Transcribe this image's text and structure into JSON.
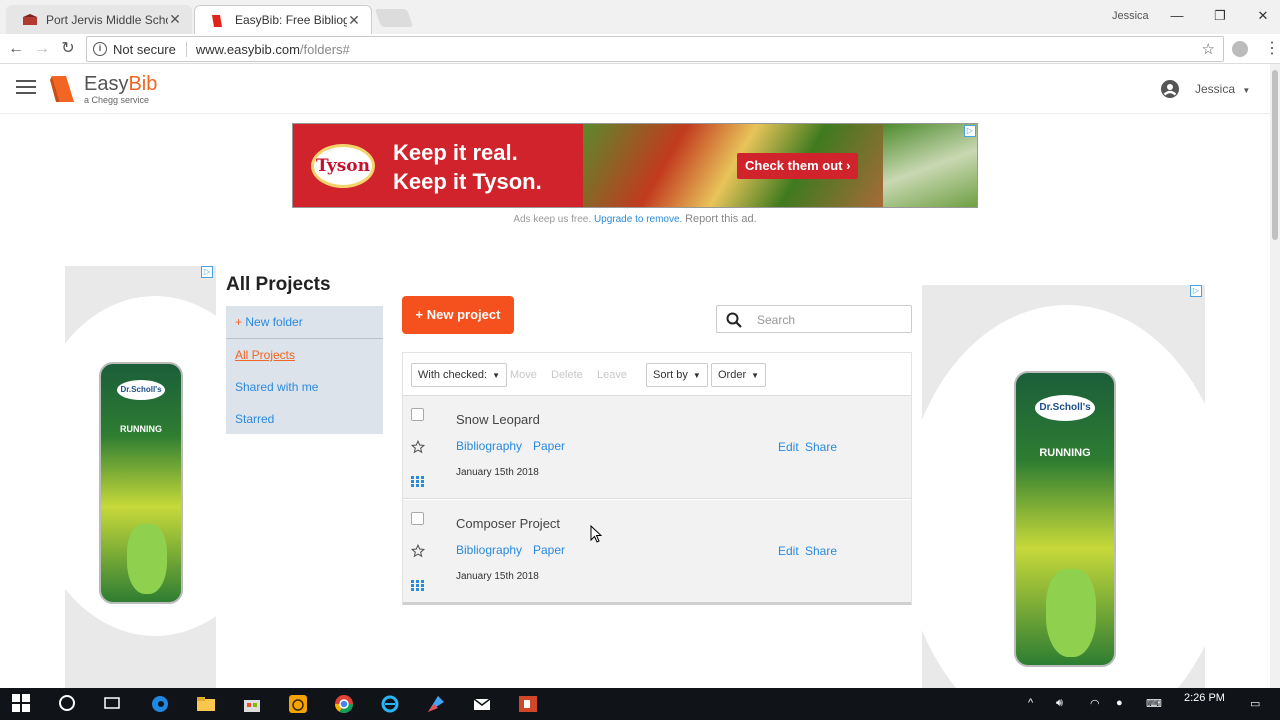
{
  "browser": {
    "tabs": [
      {
        "title": "Port Jervis Middle Schoo",
        "active": false
      },
      {
        "title": "EasyBib: Free Bibliograph",
        "active": true
      }
    ],
    "window_user": "Jessica",
    "window_controls": {
      "minimize": "—",
      "restore": "❐",
      "close": "✕"
    },
    "security": "Not secure",
    "url_host": "www.easybib.com",
    "url_path": "/folders#"
  },
  "header": {
    "brand_easy": "Easy",
    "brand_bib": "Bib",
    "tagline": "a Chegg service",
    "username": "Jessica",
    "accent": "#f26522"
  },
  "banner_ad": {
    "logo_text": "Tyson",
    "line1": "Keep it real.",
    "line2": "Keep it Tyson.",
    "cta": "Check them out ›",
    "note_prefix": "Ads keep us free.",
    "upgrade_link": "Upgrade to remove.",
    "report": "Report this ad."
  },
  "side_ads": {
    "brand": "Dr.Scholl's",
    "product": "RUNNING"
  },
  "sidebar": {
    "title": "All Projects",
    "new_folder": "New folder",
    "new_folder_prefix": "+",
    "items": [
      {
        "label": "All Projects",
        "active": true
      },
      {
        "label": "Shared with me",
        "active": false
      },
      {
        "label": "Starred",
        "active": false
      }
    ]
  },
  "main": {
    "new_project": "+ New project",
    "search_placeholder": "Search",
    "toolbar": {
      "with_checked": "With checked:",
      "move": "Move",
      "delete": "Delete",
      "leave": "Leave",
      "sort_by": "Sort by",
      "order": "Order"
    },
    "projects": [
      {
        "name": "Snow Leopard",
        "bibliography": "Bibliography",
        "paper": "Paper",
        "edit": "Edit",
        "share": "Share",
        "date": "January 15th 2018"
      },
      {
        "name": "Composer Project",
        "bibliography": "Bibliography",
        "paper": "Paper",
        "edit": "Edit",
        "share": "Share",
        "date": "January 15th 2018"
      }
    ]
  },
  "taskbar": {
    "time": "2:26 PM"
  }
}
